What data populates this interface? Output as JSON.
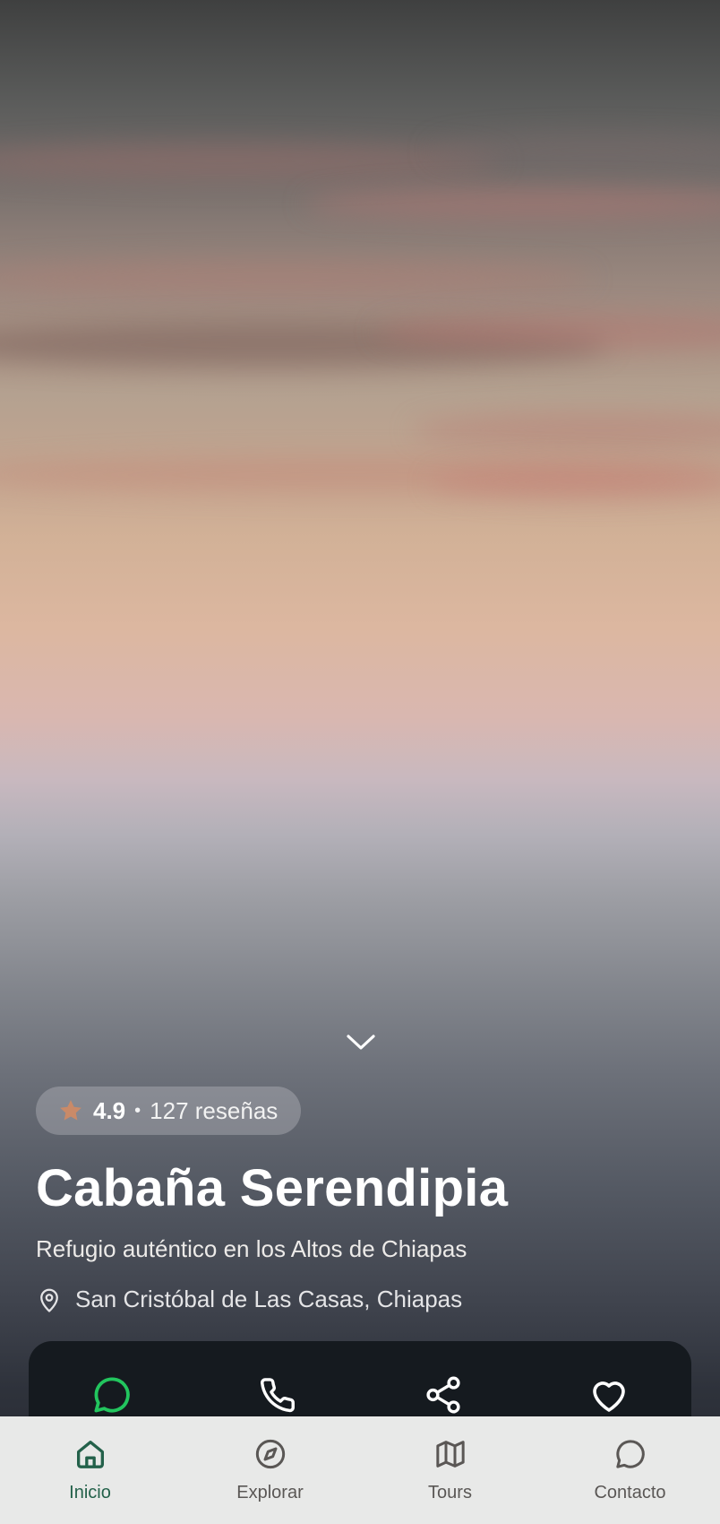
{
  "hero": {
    "scroll_hint_icon": "chevron-down-icon"
  },
  "rating": {
    "icon": "star-icon",
    "value": "4.9",
    "separator": "•",
    "reviews": "127 reseñas"
  },
  "place": {
    "title": "Cabaña Serendipia",
    "subtitle": "Refugio auténtico en los Altos de Chiapas",
    "location_icon": "map-pin-icon",
    "location": "San Cristóbal de Las Casas, Chiapas"
  },
  "actions": [
    {
      "icon": "whatsapp-chat-icon",
      "color": "#22c55e"
    },
    {
      "icon": "phone-icon",
      "color": "#ffffff"
    },
    {
      "icon": "share-icon",
      "color": "#ffffff"
    },
    {
      "icon": "heart-icon",
      "color": "#ffffff"
    }
  ],
  "bottom_nav": {
    "items": [
      {
        "label": "Inicio",
        "icon": "home-icon",
        "active": true
      },
      {
        "label": "Explorar",
        "icon": "compass-icon",
        "active": false
      },
      {
        "label": "Tours",
        "icon": "map-icon",
        "active": false
      },
      {
        "label": "Contacto",
        "icon": "chat-icon",
        "active": false
      }
    ]
  },
  "colors": {
    "accent_active": "#23614a",
    "nav_inactive": "#5a5755",
    "star": "#c98a68",
    "action_bar": "#151a1f",
    "nav_bg": "#e8e9e8"
  }
}
